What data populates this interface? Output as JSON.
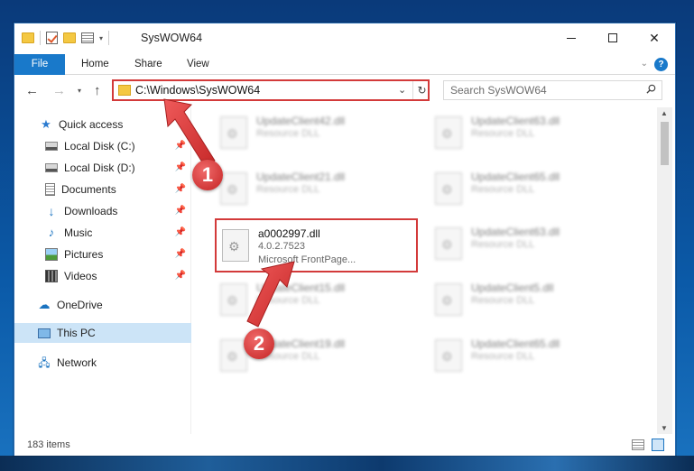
{
  "window": {
    "title": "SysWOW64"
  },
  "ribbon": {
    "tabs": [
      "File",
      "Home",
      "Share",
      "View"
    ]
  },
  "address": {
    "path": "C:\\Windows\\SysWOW64"
  },
  "search": {
    "placeholder": "Search SysWOW64"
  },
  "nav": {
    "items": [
      {
        "label": "Quick access",
        "icon": "star-icon"
      },
      {
        "label": "Local Disk (C:)",
        "icon": "disk-icon"
      },
      {
        "label": "Local Disk (D:)",
        "icon": "disk-icon"
      },
      {
        "label": "Documents",
        "icon": "documents-icon"
      },
      {
        "label": "Downloads",
        "icon": "download-icon"
      },
      {
        "label": "Music",
        "icon": "music-icon"
      },
      {
        "label": "Pictures",
        "icon": "pictures-icon"
      },
      {
        "label": "Videos",
        "icon": "videos-icon"
      },
      {
        "label": "OneDrive",
        "icon": "cloud-icon"
      },
      {
        "label": "This PC",
        "icon": "computer-icon"
      },
      {
        "label": "Network",
        "icon": "network-icon"
      }
    ]
  },
  "files": {
    "left": [
      {
        "name": "UpdateClient42.dll",
        "desc": "Resource DLL"
      },
      {
        "name": "UpdateClient21.dll",
        "desc": "Resource DLL"
      },
      {
        "name": "a0002997.dll",
        "desc": "4.0.2.7523",
        "desc2": "Microsoft FrontPage..."
      },
      {
        "name": "UpdateClient15.dll",
        "desc": "Resource DLL"
      },
      {
        "name": "UpdateClient19.dll",
        "desc": "Resource DLL"
      }
    ],
    "right": [
      {
        "name": "UpdateClient63.dll",
        "desc": "Resource DLL"
      },
      {
        "name": "UpdateClient65.dll",
        "desc": "Resource DLL"
      },
      {
        "name": "UpdateClient63.dll",
        "desc": "Resource DLL"
      },
      {
        "name": "UpdateClient5.dll",
        "desc": "Resource DLL"
      },
      {
        "name": "UpdateClient65.dll",
        "desc": "Resource DLL"
      }
    ]
  },
  "status": {
    "count": "183 items"
  },
  "annotations": {
    "step1": "1",
    "step2": "2"
  },
  "colors": {
    "highlight": "#d33a3a",
    "accent": "#1979ca"
  }
}
